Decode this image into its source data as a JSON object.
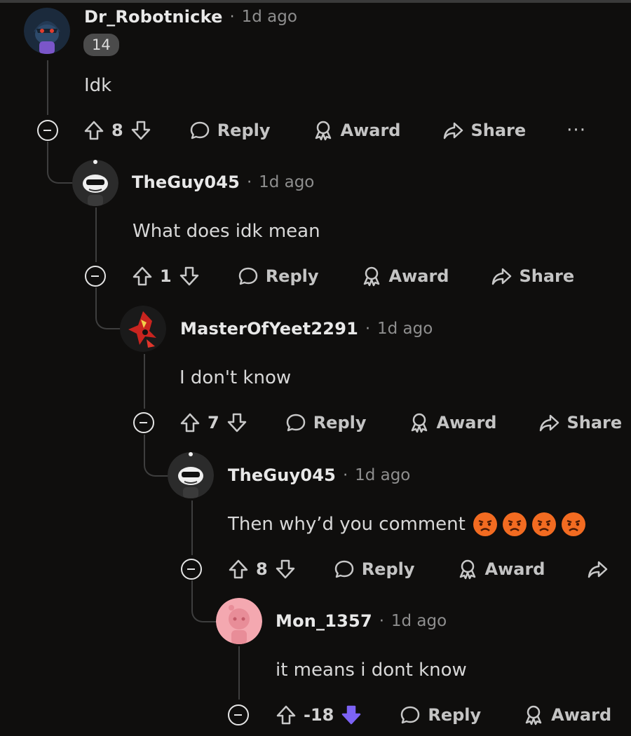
{
  "comments": [
    {
      "username": "Dr_Robotnicke",
      "time": "1d ago",
      "badge": "14",
      "body": "Idk",
      "score": "8",
      "reply": "Reply",
      "award": "Award",
      "share": "Share",
      "more": "···"
    },
    {
      "username": "TheGuy045",
      "time": "1d ago",
      "body": "What does idk mean",
      "score": "1",
      "reply": "Reply",
      "award": "Award",
      "share": "Share"
    },
    {
      "username": "MasterOfYeet2291",
      "time": "1d ago",
      "body": "I don't know",
      "score": "7",
      "reply": "Reply",
      "award": "Award",
      "share": "Share"
    },
    {
      "username": "TheGuy045",
      "time": "1d ago",
      "body": "Then why’d you comment",
      "emojis": [
        "angry-face-emoji",
        "angry-face-emoji",
        "angry-face-emoji",
        "angry-face-emoji"
      ],
      "score": "8",
      "reply": "Reply",
      "award": "Award"
    },
    {
      "username": "Mon_1357",
      "time": "1d ago",
      "body": "it means i dont know",
      "score": "-18",
      "downvoted": true,
      "reply": "Reply",
      "award": "Award"
    }
  ],
  "colors": {
    "background": "#0f0e0d",
    "downvote_active": "#7d63f5",
    "emoji": "#f26b21"
  },
  "separator": "·"
}
